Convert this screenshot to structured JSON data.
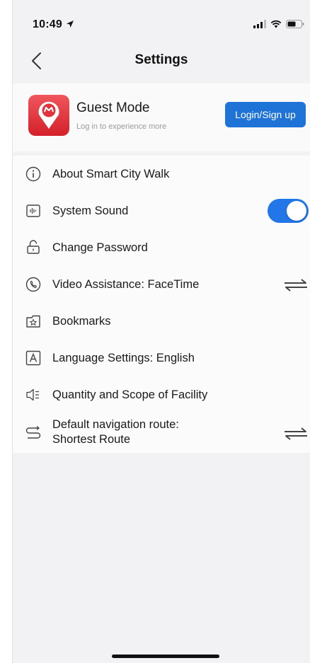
{
  "status": {
    "time": "10:49"
  },
  "nav": {
    "title": "Settings"
  },
  "profile": {
    "title": "Guest Mode",
    "subtitle": "Log in to experience more",
    "login_button": "Login/Sign up"
  },
  "settings": {
    "about": "About Smart City Walk",
    "sound": "System Sound",
    "sound_enabled": true,
    "password": "Change Password",
    "video": "Video Assistance: FaceTime",
    "bookmarks": "Bookmarks",
    "language": "Language Settings: English",
    "facility": "Quantity and Scope of Facility",
    "route_line1": "Default navigation route:",
    "route_line2": "Shortest Route"
  },
  "colors": {
    "accent": "#1f72d6",
    "toggle_on": "#2276e8",
    "logo_red": "#e0353d"
  }
}
